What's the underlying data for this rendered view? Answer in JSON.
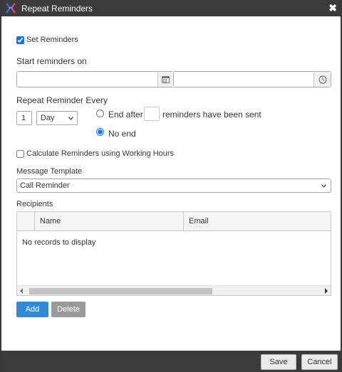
{
  "dialog": {
    "title": "Repeat Reminders"
  },
  "set_reminders": {
    "label": "Set Reminders",
    "checked": true
  },
  "start": {
    "label": "Start reminders on",
    "date_value": "",
    "time_value": ""
  },
  "repeat": {
    "label": "Repeat Reminder Every",
    "interval_value": "1",
    "unit_selected": "Day",
    "end_after_label": "End after",
    "end_after_value": "",
    "end_after_suffix": "reminders have been sent",
    "no_end_label": "No end",
    "selected_option": "no_end"
  },
  "working_hours": {
    "label": "Calculate Reminders using Working Hours",
    "checked": false
  },
  "message_template": {
    "label": "Message Template",
    "selected": "Call Reminder"
  },
  "recipients": {
    "label": "Recipients",
    "columns": [
      "Name",
      "Email"
    ],
    "empty_text": "No records to display"
  },
  "actions": {
    "add_label": "Add",
    "delete_label": "Delete"
  },
  "footer": {
    "save_label": "Save",
    "cancel_label": "Cancel"
  },
  "colors": {
    "titlebar": "#3b3b3b",
    "primary": "#2f8bd8",
    "disabled": "#9a9a9a",
    "logo_blue": "#2d6fd6",
    "logo_pink": "#e23b86"
  }
}
